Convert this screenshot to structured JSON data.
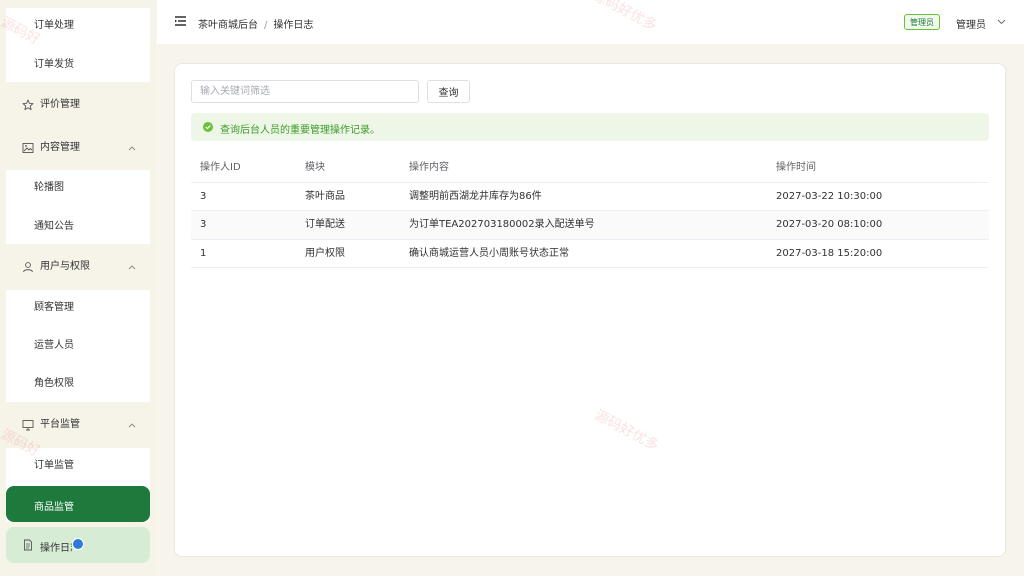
{
  "sidebar": {
    "order_items": [
      "订单处理",
      "订单发货"
    ],
    "review": "评价管理",
    "content": {
      "label": "内容管理",
      "items": [
        "轮播图",
        "通知公告"
      ]
    },
    "users": {
      "label": "用户与权限",
      "items": [
        "顾客管理",
        "运营人员",
        "角色权限"
      ]
    },
    "platform": {
      "label": "平台监管",
      "items": [
        "订单监管",
        "商品监管"
      ]
    },
    "oplog": "操作日志"
  },
  "header": {
    "breadcrumb": [
      "茶叶商城后台",
      "操作日志"
    ],
    "role_badge": "管理员",
    "user": "管理员"
  },
  "main": {
    "search": {
      "placeholder": "输入关键词筛选",
      "value": ""
    },
    "query_button": "查询",
    "notice": "查询后台人员的重要管理操作记录。",
    "table": {
      "columns": [
        "操作人ID",
        "模块",
        "操作内容",
        "操作时间"
      ],
      "rows": [
        [
          "3",
          "茶叶商品",
          "调整明前西湖龙井库存为86件",
          "2027-03-22 10:30:00"
        ],
        [
          "3",
          "订单配送",
          "为订单TEA202703180002录入配送单号",
          "2027-03-20 08:10:00"
        ],
        [
          "1",
          "用户权限",
          "确认商城运营人员小周账号状态正常",
          "2027-03-18 15:20:00"
        ]
      ]
    }
  },
  "watermark": "源码好优多",
  "colors": {
    "accent": "#1d7a3c",
    "success": "#67c23a",
    "background": "#f7f4ec"
  }
}
